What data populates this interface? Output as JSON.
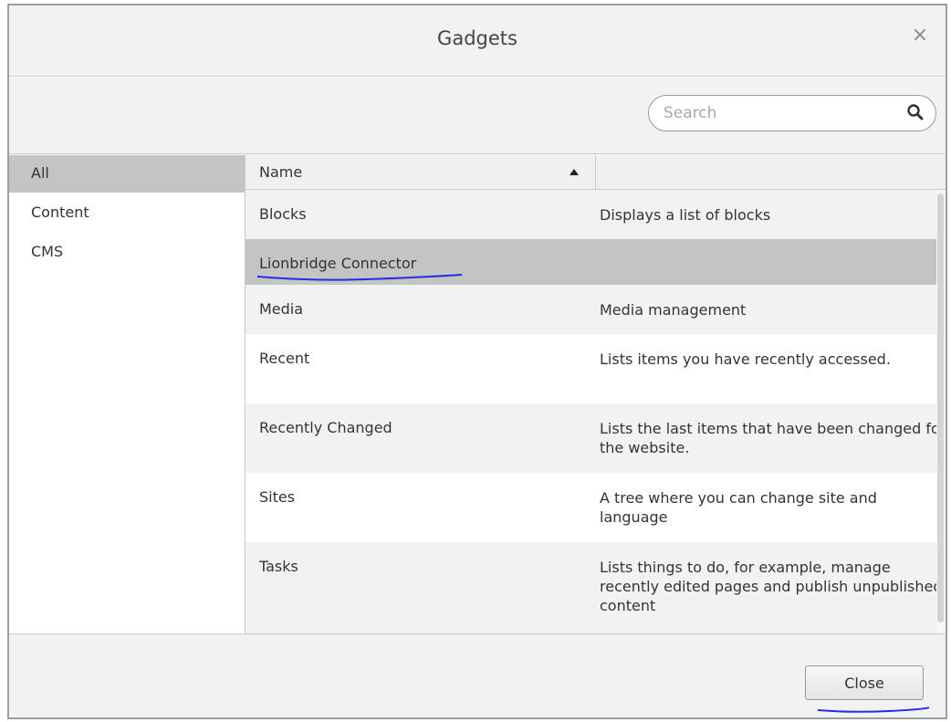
{
  "dialog": {
    "title": "Gadgets",
    "close_glyph": "×",
    "close_icon": "close-icon"
  },
  "search": {
    "placeholder": "Search",
    "value": "",
    "icon": "search-icon"
  },
  "sidebar": {
    "items": [
      {
        "label": "All",
        "active": true
      },
      {
        "label": "Content",
        "active": false
      },
      {
        "label": "CMS",
        "active": false
      }
    ]
  },
  "grid": {
    "columns": [
      {
        "label": "Name",
        "sort": "ascending"
      },
      {
        "label": ""
      }
    ],
    "rows": [
      {
        "name": "Blocks",
        "description": "Displays a list of blocks"
      },
      {
        "name": "Lionbridge Connector",
        "description": "",
        "selected": true
      },
      {
        "name": "Media",
        "description": "Media management"
      },
      {
        "name": "Recent",
        "description": "Lists items you have recently accessed."
      },
      {
        "name": "Recently Changed",
        "description": "Lists the last items that have been changed for the website."
      },
      {
        "name": "Sites",
        "description": "A tree where you can change site and language"
      },
      {
        "name": "Tasks",
        "description": "Lists things to do, for example, manage recently edited pages and publish unpublished content"
      }
    ]
  },
  "footer": {
    "close_label": "Close"
  },
  "colors": {
    "selected_row": "#c4c4c4",
    "annotation_ink": "#2a2ae0"
  }
}
